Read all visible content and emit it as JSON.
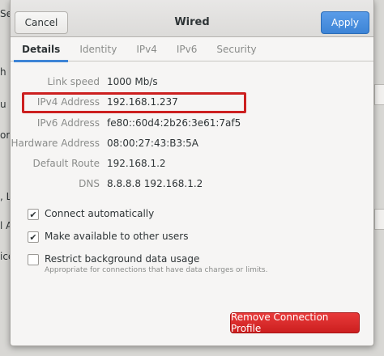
{
  "background": {
    "fragments": [
      "Se",
      "h",
      "u",
      "or",
      ", L",
      "l A",
      "icc"
    ]
  },
  "dialog": {
    "title": "Wired",
    "cancel_label": "Cancel",
    "apply_label": "Apply",
    "tabs": [
      "Details",
      "Identity",
      "IPv4",
      "IPv6",
      "Security"
    ],
    "active_tab": "Details",
    "details": [
      {
        "label": "Link speed",
        "value": "1000 Mb/s"
      },
      {
        "label": "IPv4 Address",
        "value": "192.168.1.237"
      },
      {
        "label": "IPv6 Address",
        "value": "fe80::60d4:2b26:3e61:7af5"
      },
      {
        "label": "Hardware Address",
        "value": "08:00:27:43:B3:5A"
      },
      {
        "label": "Default Route",
        "value": "192.168.1.2"
      },
      {
        "label": "DNS",
        "value": "8.8.8.8 192.168.1.2"
      }
    ],
    "checkboxes": [
      {
        "label": "Connect automatically",
        "checked": true
      },
      {
        "label": "Make available to other users",
        "checked": true
      },
      {
        "label": "Restrict background data usage",
        "sublabel": "Appropriate for connections that have data charges or limits.",
        "checked": false
      }
    ],
    "remove_label": "Remove Connection Profile",
    "colors": {
      "accent": "#3d84d6",
      "destructive": "#cc1f1f",
      "highlight": "#cc1f1f"
    }
  }
}
